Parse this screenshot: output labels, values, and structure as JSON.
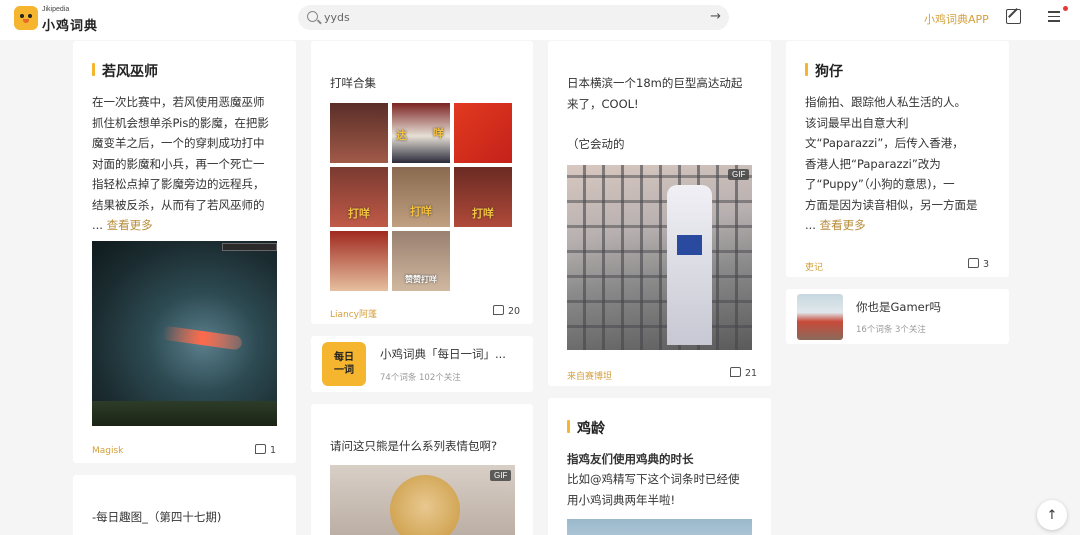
{
  "header": {
    "brand_small": "Jikipedia",
    "brand_big": "小鸡词典",
    "search_value": "yyds",
    "search_go": "→",
    "app_link": "小鸡词典APP",
    "to_top": "↑"
  },
  "col1": {
    "card1": {
      "title": "若风巫师",
      "lines": [
        "在一次比赛中，若风使用恶魔巫师",
        "抓住机会想单杀Pis的影魔，在把影",
        "魔变羊之后，一个的穿刺成功打中",
        "对面的影魔和小兵，再一个死亡一",
        "指轻松点掉了影魔旁边的远程兵，",
        "结果被反杀，从而有了若风巫师的"
      ],
      "ellipsis": "...",
      "more": "查看更多",
      "author": "Magisk",
      "likes": "1"
    },
    "card2": {
      "title": "-每日趣图_（第四十七期)"
    }
  },
  "col2": {
    "card1": {
      "title": "打咩合集",
      "captions": [
        "达",
        "咩",
        "打咩",
        "打咩",
        "打咩",
        "赞赞打咩"
      ],
      "author": "Liancy阿蓬",
      "likes": "20"
    },
    "card2": {
      "badge_top": "每日",
      "badge_bottom": "一词",
      "title": "小鸡词典「每日一词」...",
      "meta": "74个词条  102个关注"
    },
    "card3": {
      "title": "请问这只熊是什么系列表情包啊?",
      "gif": "GIF"
    }
  },
  "col3": {
    "card1": {
      "lines": [
        "日本横滨一个18m的巨型高达动起",
        "来了，COOL!"
      ],
      "line3": "（它会动的",
      "gif": "GIF",
      "author": "来自赛博坦",
      "likes": "21"
    },
    "card2": {
      "title": "鸡龄",
      "subtitle": "指鸡友们使用鸡典的时长",
      "lines": [
        "比如@鸡精写下这个词条时已经使",
        "用小鸡词典两年半啦!"
      ]
    }
  },
  "col4": {
    "card1": {
      "title": "狗仔",
      "lines": [
        "指偷拍、跟踪他人私生活的人。",
        "该词最早出自意大利",
        "文“Paparazzi”，后传入香港，",
        "香港人把“Paparazzi”改为",
        "了“Puppy”（小狗的意思)，一",
        "方面是因为读音相似，另一方面是"
      ],
      "ellipsis": "...",
      "more": "查看更多",
      "author": "吏记",
      "likes": "3"
    },
    "card2": {
      "title": "你也是Gamer吗",
      "meta": "16个词条  3个关注"
    }
  }
}
